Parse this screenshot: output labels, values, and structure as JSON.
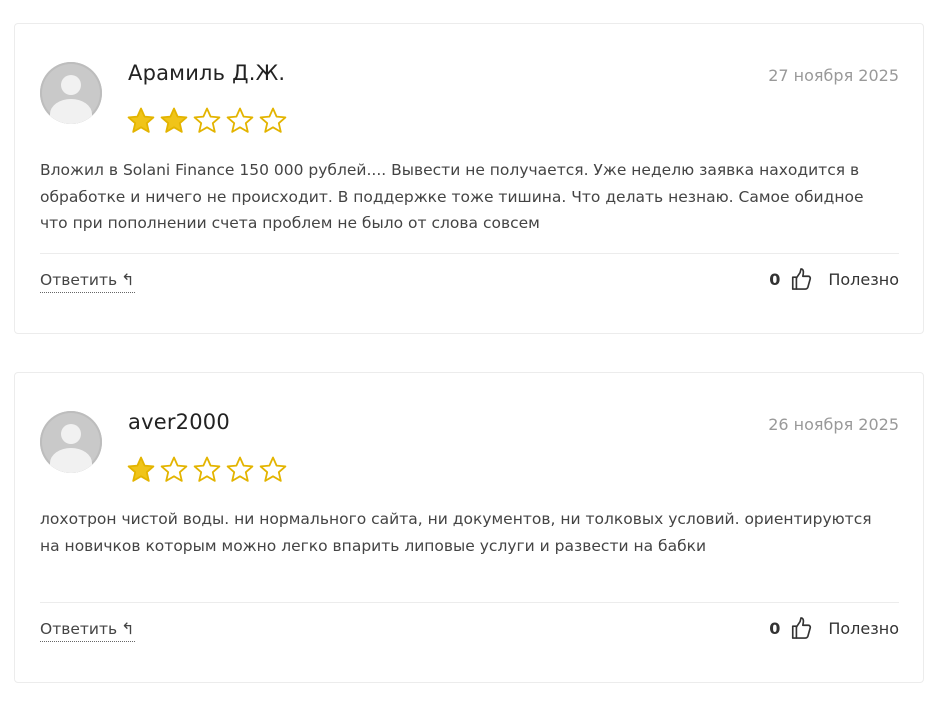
{
  "reviews": [
    {
      "author": "Арамиль Д.Ж.",
      "date": "27 ноября 2025",
      "rating": 2,
      "max_rating": 5,
      "text": "Вложил в Solani Finance 150 000 рублей.... Вывести не получается. Уже неделю заявка находится в обработке и ничего не происходит. В поддержке тоже тишина. Что делать незнаю. Самое обидное что при пополнении счета проблем не было от слова совсем",
      "reply_label": "Ответить",
      "helpful_count": "0",
      "helpful_label": "Полезно"
    },
    {
      "author": "aver2000",
      "date": "26 ноября 2025",
      "rating": 1,
      "max_rating": 5,
      "text": "лохотрон чистой воды. ни нормального сайта, ни документов, ни толковых условий. ориентируются на новичков которым можно легко впарить липовые услуги и развести на бабки",
      "reply_label": "Ответить",
      "helpful_count": "0",
      "helpful_label": "Полезно"
    }
  ],
  "icons": {
    "star_filled": "star-filled-icon",
    "star_empty": "star-empty-icon",
    "reply": "reply-arrow-icon",
    "thumb": "thumbs-up-icon",
    "avatar": "user-avatar-placeholder"
  },
  "colors": {
    "star": "#f0c419",
    "star_stroke": "#e3b400",
    "muted_text": "#999999",
    "border": "#ececec"
  }
}
